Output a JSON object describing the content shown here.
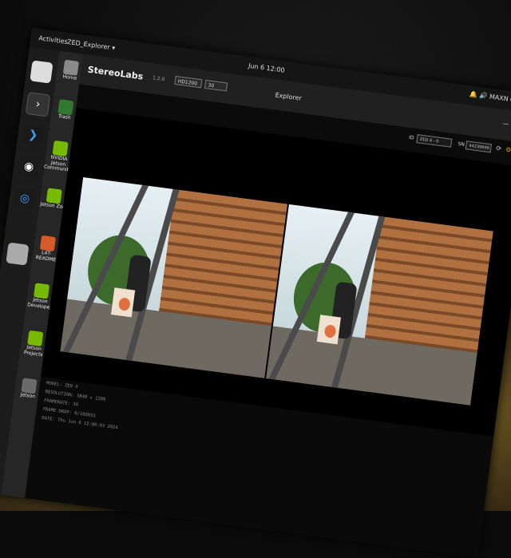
{
  "topbar": {
    "activities": "Activities",
    "app_menu": "ZED_Explorer ▾",
    "clock": "Jun 6 12:00",
    "tray": "🔔 🔊 MAXN ⏻"
  },
  "desktop": {
    "items": [
      {
        "label": "Home",
        "color": "#8a8a8a"
      },
      {
        "label": "Trash",
        "color": "#2f7a2f"
      },
      {
        "label": "NVIDIA Jetson Community",
        "color": "#76b900"
      },
      {
        "label": "Jetson Zoo",
        "color": "#76b900"
      },
      {
        "label": "L4T-README",
        "color": "#d65a2a"
      },
      {
        "label": "Jetson Developer",
        "color": "#76b900"
      },
      {
        "label": "Jetson Projects",
        "color": "#76b900"
      },
      {
        "label": "Jetson",
        "color": "#6a6a6a"
      }
    ]
  },
  "app": {
    "brand": "StereoLabs",
    "version": "1.2.0",
    "resolution_select": "HD1200",
    "fps_select": "30",
    "title": "Explorer",
    "camera_label": "ID",
    "camera_select": "ZED X  - 0",
    "sn_label": "SN",
    "serial_value": "44239999"
  },
  "info": {
    "model": "MODEL: ZED X",
    "resolution": "RESOLUTION: 3840 x 1200",
    "framerate": "FRAMERATE: 30",
    "frame_drop": "FRAME DROP: 0/100033",
    "date": "DATE: Thu Jun 6 12:00:03 2024"
  }
}
